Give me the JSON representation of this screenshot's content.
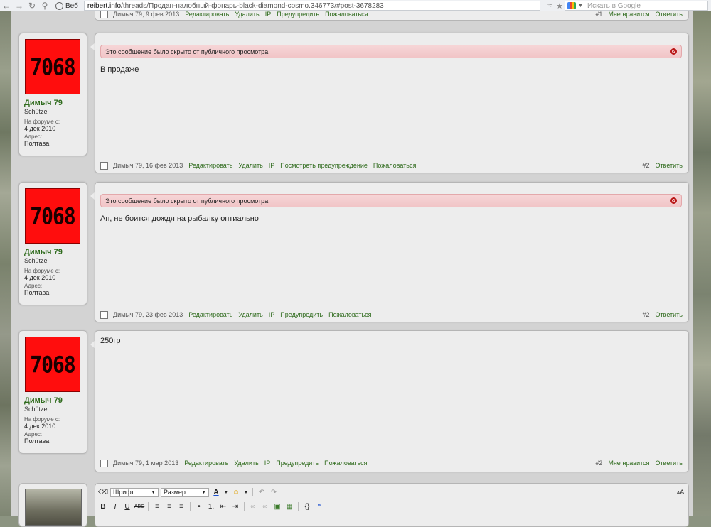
{
  "browser": {
    "tab_label": "Веб",
    "url_host": "reibert.info",
    "url_path": "/threads/Продан-налобный-фонарь-black-diamond-cosmo.346773/#post-3678283",
    "search_placeholder": "Искать в Google"
  },
  "top_post": {
    "meta": "Димыч 79, 9 фев 2013",
    "actions": [
      "Редактировать",
      "Удалить",
      "IP",
      "Предупредить",
      "Пожаловаться"
    ],
    "num": "#1",
    "like": "Мне нравится",
    "reply": "Ответить"
  },
  "user": {
    "avatar_text": "7068",
    "name": "Димыч 79",
    "title": "Schütze",
    "joined_label": "На форуме с:",
    "joined": "4 дек 2010",
    "address_label": "Адрес:",
    "address": "Полтава"
  },
  "posts": [
    {
      "hidden_notice": "Это сообщение было скрыто от публичного просмотра.",
      "text": "В продаже",
      "meta": "Димыч 79, 16 фев 2013",
      "actions": [
        "Редактировать",
        "Удалить",
        "IP",
        "Посмотреть предупреждение",
        "Пожаловаться"
      ],
      "num": "#2",
      "reply": "Ответить"
    },
    {
      "hidden_notice": "Это сообщение было скрыто от публичного просмотра.",
      "text": "Ап, не боится дождя на рыбалку оптиально",
      "meta": "Димыч 79, 23 фев 2013",
      "actions": [
        "Редактировать",
        "Удалить",
        "IP",
        "Предупредить",
        "Пожаловаться"
      ],
      "num": "#2",
      "reply": "Ответить"
    },
    {
      "text": "250гр",
      "meta": "Димыч 79, 1 мар 2013",
      "actions": [
        "Редактировать",
        "Удалить",
        "IP",
        "Предупредить",
        "Пожаловаться"
      ],
      "num": "#2",
      "like": "Мне нравится",
      "reply": "Ответить"
    }
  ],
  "editor": {
    "font_select": "Шрифт",
    "size_select": "Размер"
  }
}
